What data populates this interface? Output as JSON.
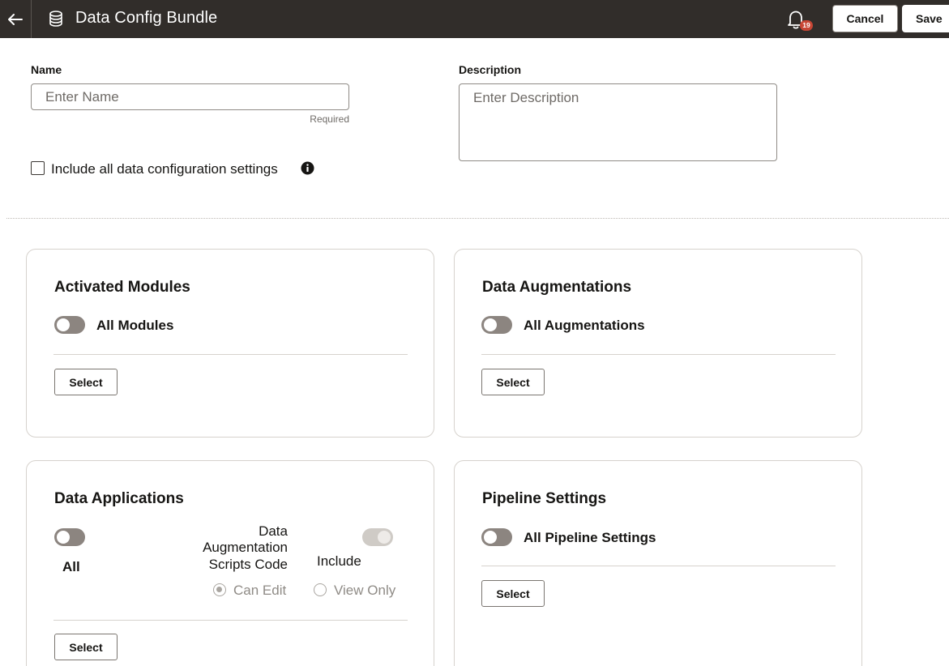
{
  "header": {
    "title": "Data Config Bundle",
    "back_icon": "arrow-left-icon",
    "app_icon": "database-icon",
    "notification_count": "19",
    "cancel_label": "Cancel",
    "save_label": "Save",
    "background_color": "#312d2a"
  },
  "form": {
    "name_label": "Name",
    "name_placeholder": "Enter Name",
    "name_value": "",
    "name_hint": "Required",
    "description_label": "Description",
    "description_placeholder": "Enter Description",
    "description_value": "",
    "include_all_label": "Include all data configuration settings",
    "include_all_checked": false
  },
  "cards": {
    "activated_modules": {
      "title": "Activated Modules",
      "toggle_label": "All Modules",
      "toggle_on": false,
      "select_label": "Select"
    },
    "data_augmentations": {
      "title": "Data Augmentations",
      "toggle_label": "All Augmentations",
      "toggle_on": false,
      "select_label": "Select"
    },
    "data_applications": {
      "title": "Data Applications",
      "all_label": "All",
      "all_on": false,
      "scripts_label_line1": "Data",
      "scripts_label_line2": "Augmentation",
      "scripts_label_line3": "Scripts Code",
      "include_label": "Include",
      "include_on": false,
      "radio_can_edit": "Can Edit",
      "radio_view_only": "View Only",
      "selected_radio": "Can Edit",
      "select_label": "Select"
    },
    "pipeline_settings": {
      "title": "Pipeline Settings",
      "toggle_label": "All Pipeline Settings",
      "toggle_on": false,
      "select_label": "Select"
    }
  }
}
